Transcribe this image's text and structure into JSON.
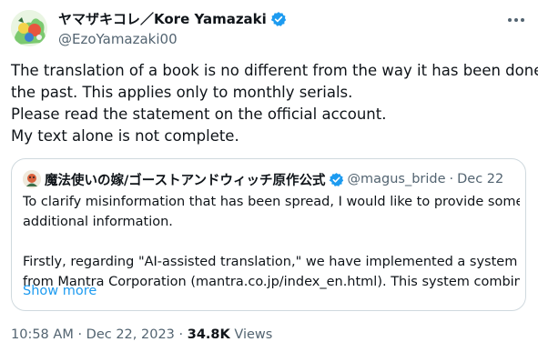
{
  "author": {
    "display_name": "ヤマザキコレ／Kore Yamazaki",
    "handle": "@EzoYamazaki00",
    "verified_icon": "verified-badge-icon",
    "avatar": "author-avatar-illustration"
  },
  "more_icon": "more-options-icon",
  "tweet_lines": [
    "The translation of a book is no different from the way it has been done in",
    "the past. This applies only to monthly serials.",
    "Please read the statement on the official account.",
    "My text alone is not complete."
  ],
  "quoted": {
    "display_name": "魔法使いの嫁/ゴーストアンドウィッチ原作公式",
    "handle": "@magus_bride",
    "separator": "·",
    "date": "Dec 22",
    "lines": [
      "To clarify misinformation that has been spread, I would like to provide some",
      "additional information.",
      "",
      "Firstly, regarding \"AI-assisted translation,\" we have implemented a system",
      "from Mantra Corporation (mantra.co.jp/index_en.html). This system combine..."
    ],
    "show_more": "Show more"
  },
  "footer": {
    "time": "10:58 AM",
    "separator": "·",
    "date": "Dec 22, 2023",
    "views_count": "34.8K",
    "views_label": "Views"
  },
  "colors": {
    "text": "#0f1419",
    "secondary": "#536471",
    "accent": "#1d9bf0",
    "border": "#cfd9de"
  }
}
